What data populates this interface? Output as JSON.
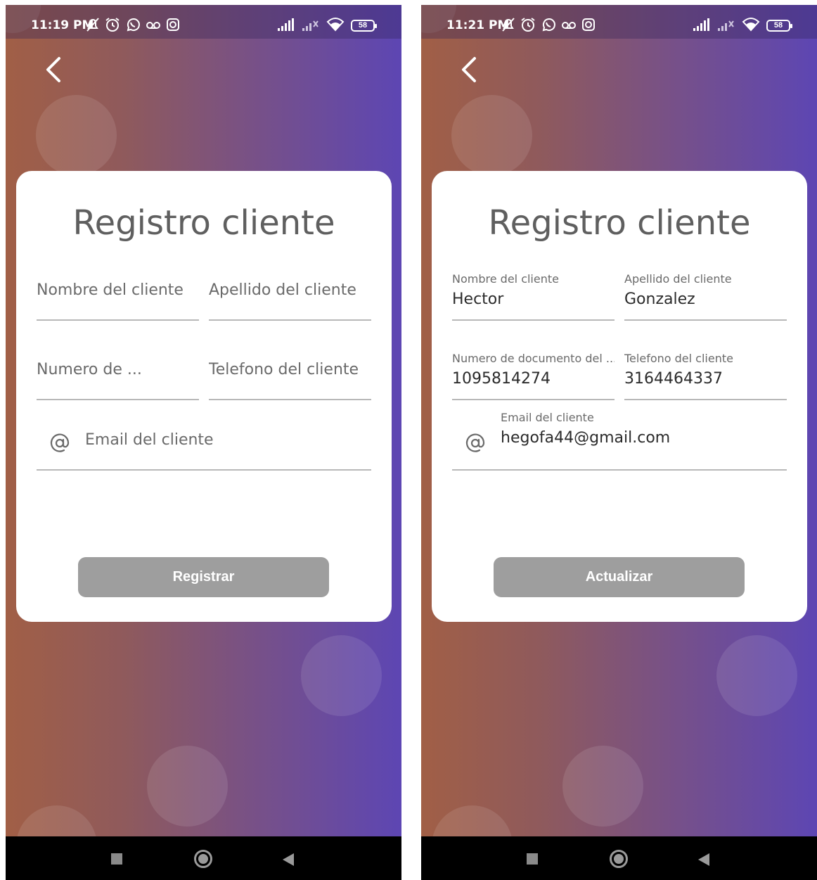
{
  "screens": [
    {
      "status": {
        "time": "11:19 PM",
        "battery": "58"
      },
      "form": {
        "title": "Registro cliente",
        "fields": {
          "nombre": {
            "label": "Nombre del cliente",
            "value": ""
          },
          "apellido": {
            "label": "Apellido del cliente",
            "value": ""
          },
          "numero": {
            "label": "Numero de ...",
            "value": ""
          },
          "telefono": {
            "label": "Telefono del cliente",
            "value": ""
          },
          "email": {
            "label": "Email del cliente",
            "value": ""
          }
        },
        "button_label": "Registrar"
      }
    },
    {
      "status": {
        "time": "11:21 PM",
        "battery": "58"
      },
      "form": {
        "title": "Registro cliente",
        "fields": {
          "nombre": {
            "label": "Nombre del cliente",
            "value": "Hector"
          },
          "apellido": {
            "label": "Apellido del cliente",
            "value": "Gonzalez"
          },
          "numero": {
            "label": "Numero de documento del ...",
            "value": "1095814274"
          },
          "telefono": {
            "label": "Telefono del cliente",
            "value": "3164464337"
          },
          "email": {
            "label": "Email del cliente",
            "value": "hegofa44@gmail.com"
          }
        },
        "button_label": "Actualizar"
      }
    }
  ],
  "icons": {
    "status_left": [
      "bell-off-icon",
      "alarm-icon",
      "whatsapp-icon",
      "voicemail-icon",
      "instagram-icon"
    ],
    "status_right": [
      "signal-icon",
      "signal-weak-icon",
      "wifi-icon",
      "battery-icon"
    ],
    "back": "back-arrow-icon",
    "email": "at-sign-icon",
    "nav": [
      "recents-icon",
      "home-icon",
      "back-triangle-icon"
    ]
  },
  "colors": {
    "gradient_start": "#a15f46",
    "gradient_end": "#5d46b3",
    "card": "#ffffff",
    "button": "#9e9e9e",
    "title_text": "#5f5f5f"
  }
}
